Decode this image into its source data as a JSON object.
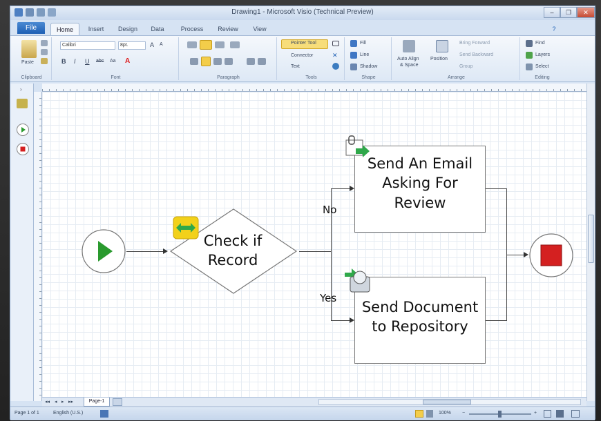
{
  "window": {
    "title": "Drawing1 - Microsoft Visio (Technical Preview)",
    "file_tab": "File",
    "tabs": [
      "Home",
      "Insert",
      "Design",
      "Data",
      "Process",
      "Review",
      "View"
    ],
    "active_tab": "Home",
    "controls": [
      "–",
      "❐",
      "✕"
    ]
  },
  "ribbon": {
    "clipboard": {
      "paste": "Paste",
      "label": "Clipboard"
    },
    "font": {
      "family": "Calibri",
      "size": "8pt.",
      "grow": "A",
      "shrink": "A",
      "bold": "B",
      "italic": "I",
      "underline": "U",
      "strike": "abc",
      "case": "Aa",
      "color": "A",
      "label": "Font"
    },
    "paragraph": {
      "label": "Paragraph"
    },
    "tools": {
      "pointer": "Pointer Tool",
      "connector": "Connector",
      "text": "Text",
      "label": "Tools"
    },
    "shape": {
      "fill": "Fill",
      "line": "Line",
      "shadow": "Shadow",
      "label": "Shape"
    },
    "arrange": {
      "auto_align": "Auto Align",
      "auto_space": "& Space",
      "position": "Position",
      "bring_forward": "Bring Forward",
      "send_backward": "Send Backward",
      "group": "Group",
      "label": "Arrange"
    },
    "editing": {
      "find": "Find",
      "layers": "Layers",
      "select": "Select",
      "label": "Editing"
    }
  },
  "diagram": {
    "decision_label": "Check if Record",
    "email_label": "Send An Email Asking For Review",
    "document_label": "Send Document to Repository",
    "no_label": "No",
    "yes_label": "Yes",
    "start_icon": "start-play-icon",
    "end_icon": "end-stop-icon",
    "colors": {
      "start_green": "#2a9a2e",
      "end_red": "#d42020",
      "action_yellow": "#f2d11a",
      "action_green": "#2fa84a"
    }
  },
  "pages": {
    "nav": [
      "◂◂",
      "◂",
      "▸",
      "▸▸"
    ],
    "current": "Page-1"
  },
  "status": {
    "page": "Page 1 of 1",
    "language": "English (U.S.)",
    "zoom": "100%"
  }
}
